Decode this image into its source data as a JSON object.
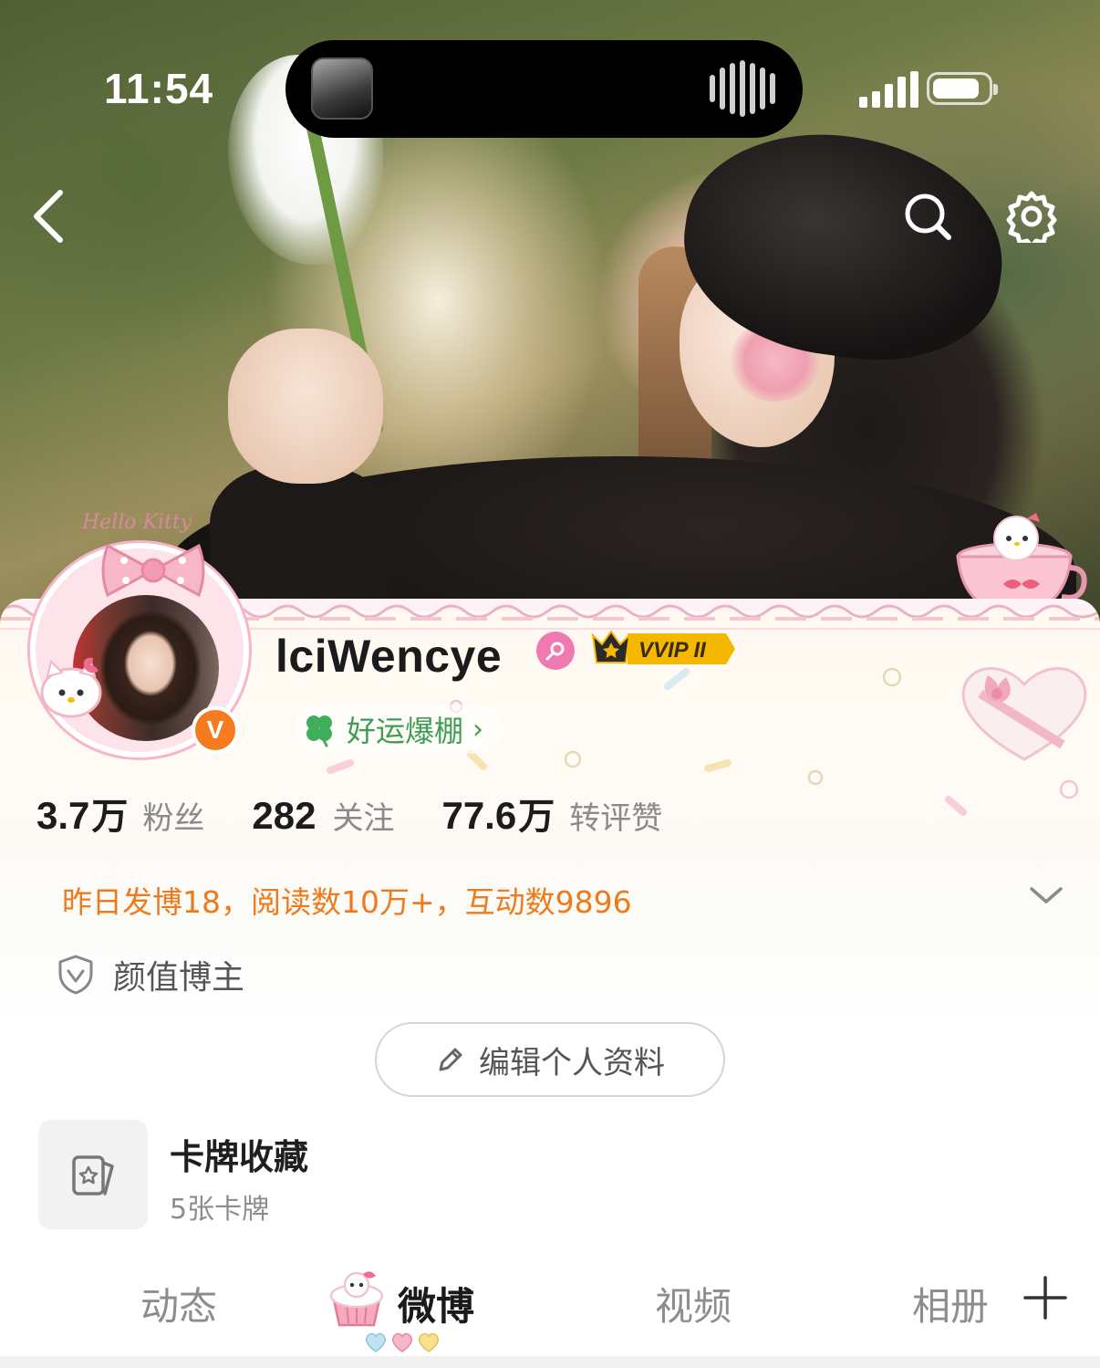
{
  "status_bar": {
    "time": "11:54"
  },
  "header": {
    "back_icon": "chevron-left-icon",
    "search_icon": "search-icon",
    "settings_icon": "gear-icon"
  },
  "profile": {
    "username": "lciWencye",
    "gender_icon": "female-icon",
    "vip_badge": "VVIP II",
    "verified_badge": "V",
    "avatar_frame_text": "Hello Kitty",
    "luck_tag": "好运爆棚",
    "luck_chevron": "›"
  },
  "stats": [
    {
      "number": "3.7",
      "unit": "万",
      "label": "粉丝"
    },
    {
      "number": "282",
      "unit": "",
      "label": "关注"
    },
    {
      "number": "77.6",
      "unit": "万",
      "label": "转评赞"
    }
  ],
  "activity_summary": "昨日发博18，阅读数10万+，互动数9896",
  "category_tag": "颜值博主",
  "edit_profile_button": "编辑个人资料",
  "card_collection": {
    "title": "卡牌收藏",
    "subtitle": "5张卡牌"
  },
  "tabs": [
    {
      "label": "动态",
      "active": false
    },
    {
      "label": "微博",
      "active": true
    },
    {
      "label": "视频",
      "active": false
    },
    {
      "label": "相册",
      "active": false
    }
  ],
  "colors": {
    "accent_orange": "#ef7a1c",
    "luck_green": "#3f9d53",
    "verified_orange": "#f47b1f",
    "gender_pink": "#f07ab0",
    "vip_gold": "#f5b800"
  }
}
